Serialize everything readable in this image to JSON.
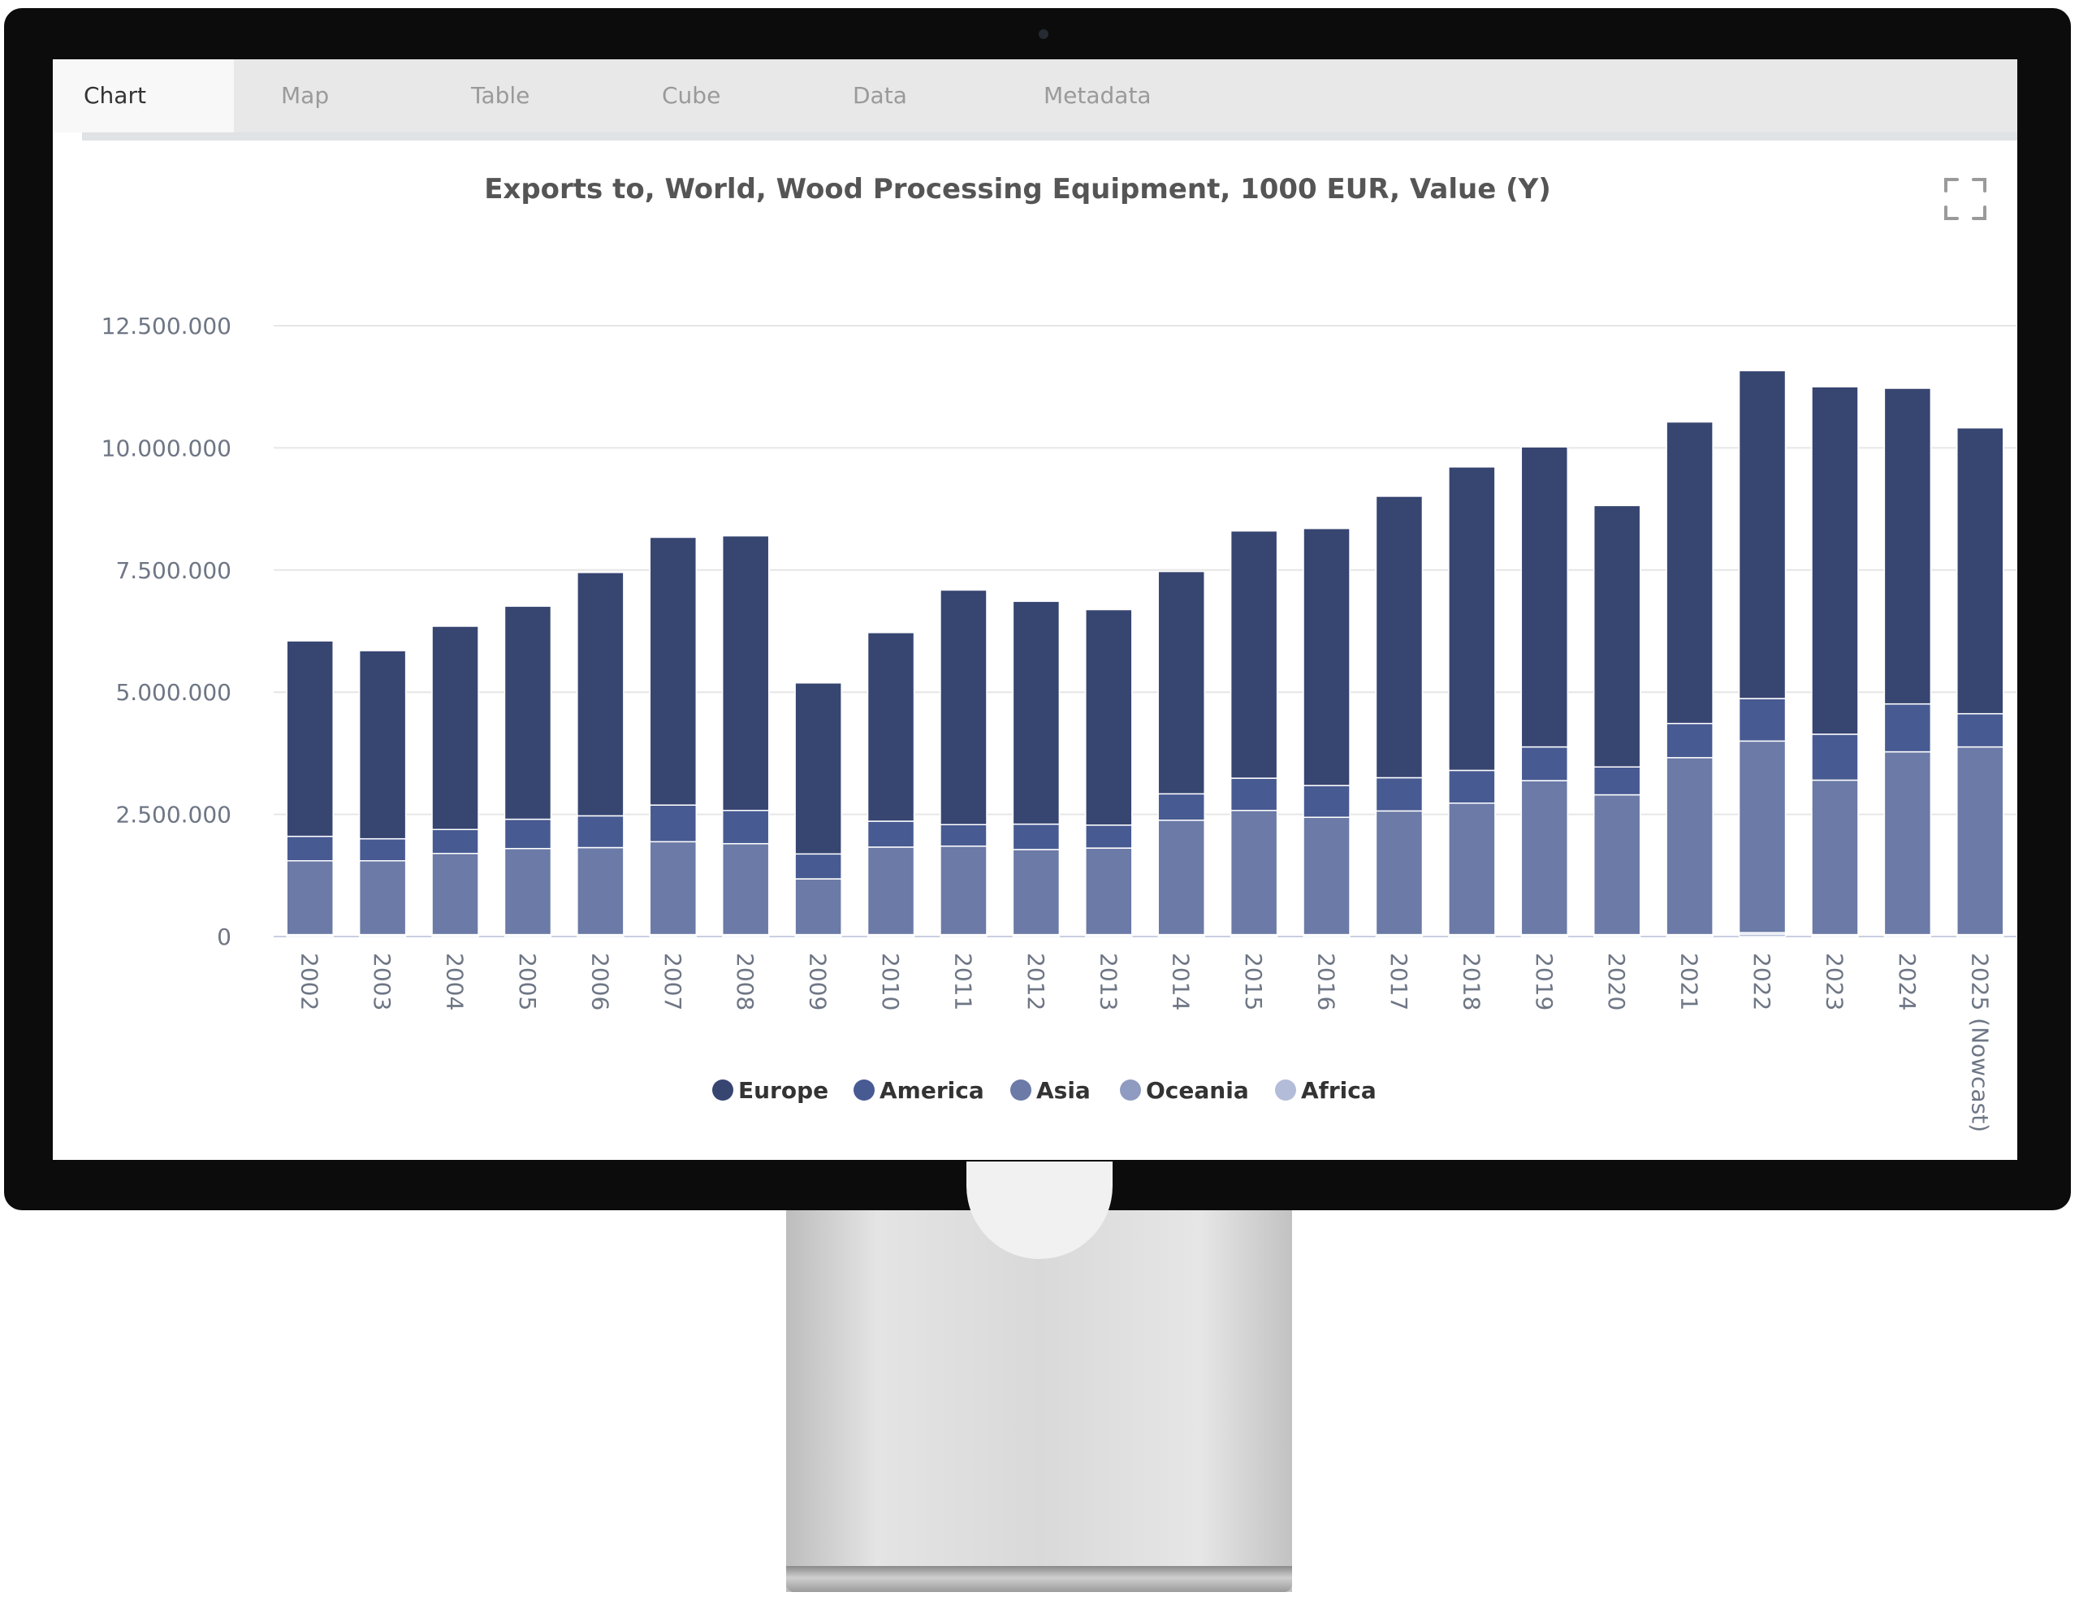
{
  "tabs": [
    {
      "label": "Chart",
      "active": true
    },
    {
      "label": "Map",
      "active": false
    },
    {
      "label": "Table",
      "active": false
    },
    {
      "label": "Cube",
      "active": false
    },
    {
      "label": "Data",
      "active": false
    },
    {
      "label": "Metadata",
      "active": false
    }
  ],
  "icons": {
    "fullscreen": "fullscreen-icon"
  },
  "colors": {
    "Europe": "#374571",
    "America": "#475a92",
    "Asia": "#6b7aa6",
    "Oceania": "#8f9bc0",
    "Africa": "#b3bcd8"
  },
  "chart_data": {
    "type": "bar",
    "stacked": true,
    "title": "Exports to, World, Wood Processing Equipment, 1000 EUR, Value (Y)",
    "xlabel": "",
    "ylabel": "",
    "ylim": [
      0,
      12500000
    ],
    "yticks": [
      "0",
      "2.500.000",
      "5.000.000",
      "7.500.000",
      "10.000.000",
      "12.500.000"
    ],
    "grid": true,
    "legend_position": "bottom",
    "categories": [
      "2002",
      "2003",
      "2004",
      "2005",
      "2006",
      "2007",
      "2008",
      "2009",
      "2010",
      "2011",
      "2012",
      "2013",
      "2014",
      "2015",
      "2016",
      "2017",
      "2018",
      "2019",
      "2020",
      "2021",
      "2022",
      "2023",
      "2024",
      "2025 (Nowcast)"
    ],
    "series": [
      {
        "name": "Africa",
        "values": [
          20000,
          20000,
          20000,
          20000,
          20000,
          20000,
          20000,
          20000,
          20000,
          20000,
          20000,
          20000,
          20000,
          20000,
          20000,
          20000,
          20000,
          20000,
          20000,
          20000,
          50000,
          20000,
          20000,
          20000
        ]
      },
      {
        "name": "Oceania",
        "values": [
          20000,
          20000,
          20000,
          20000,
          20000,
          20000,
          20000,
          20000,
          20000,
          20000,
          20000,
          20000,
          20000,
          20000,
          20000,
          20000,
          20000,
          20000,
          20000,
          20000,
          30000,
          20000,
          20000,
          20000
        ]
      },
      {
        "name": "Asia",
        "values": [
          1510000,
          1510000,
          1660000,
          1760000,
          1780000,
          1900000,
          1860000,
          1140000,
          1790000,
          1810000,
          1740000,
          1770000,
          2340000,
          2540000,
          2400000,
          2530000,
          2690000,
          3150000,
          2860000,
          3620000,
          3920000,
          3160000,
          3740000,
          3840000
        ]
      },
      {
        "name": "America",
        "values": [
          500000,
          450000,
          490000,
          600000,
          650000,
          750000,
          680000,
          510000,
          530000,
          440000,
          520000,
          470000,
          540000,
          660000,
          650000,
          680000,
          670000,
          690000,
          570000,
          700000,
          870000,
          940000,
          980000,
          680000
        ]
      },
      {
        "name": "Europe",
        "values": [
          4000000,
          3850000,
          4160000,
          4360000,
          4980000,
          5480000,
          5620000,
          3500000,
          3860000,
          4800000,
          4560000,
          4410000,
          4550000,
          5060000,
          5260000,
          5760000,
          6210000,
          6140000,
          5350000,
          6170000,
          6710000,
          7110000,
          6460000,
          5850000
        ]
      }
    ]
  }
}
